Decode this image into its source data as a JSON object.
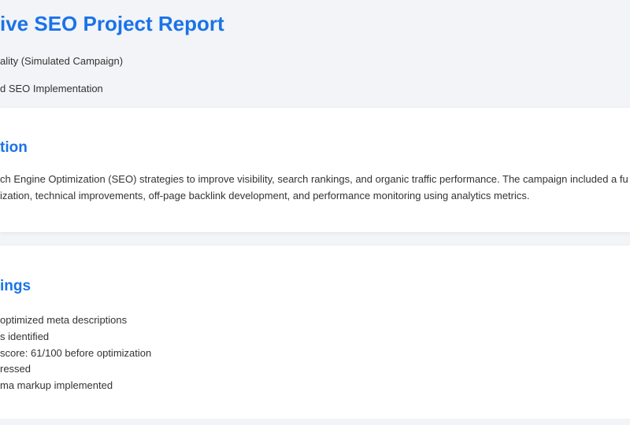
{
  "header": {
    "title": "ive SEO Project Report",
    "meta_line_1": "ality (Simulated Campaign)",
    "meta_line_2": "d SEO Implementation"
  },
  "introduction": {
    "heading": "tion",
    "lines": [
      "ch Engine Optimization (SEO) strategies to improve visibility, search rankings, and organic traffic performance. The campaign included a fu",
      "ization, technical improvements, off-page backlink development, and performance monitoring using analytics metrics."
    ]
  },
  "findings": {
    "heading": "ings",
    "items": [
      "optimized meta descriptions",
      "s identified",
      " score: 61/100 before optimization",
      "ressed",
      "ma markup implemented"
    ]
  },
  "colors": {
    "accent": "#1a73e8",
    "background": "#f2f4f7",
    "card": "#ffffff",
    "text": "#333333"
  }
}
